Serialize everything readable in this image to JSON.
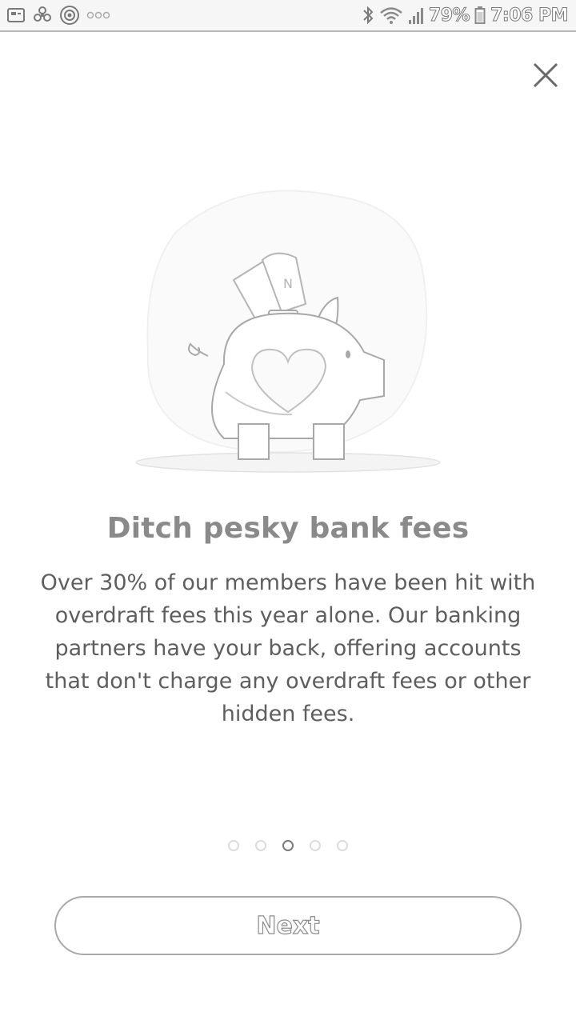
{
  "status_bar": {
    "notification_icons": [
      "gallery-notification-icon",
      "pinwheel-notification-icon",
      "target-notification-icon",
      "more-notifications-icon"
    ],
    "bluetooth_icon": "bluetooth-icon",
    "wifi_icon": "wifi-icon",
    "signal_icon": "signal-icon",
    "battery_percent": "79%",
    "battery_icon": "battery-icon",
    "time": "7:06 PM"
  },
  "onboarding": {
    "close_icon": "close-icon",
    "illustration": "piggy-bank-illustration",
    "title": "Ditch pesky bank fees",
    "body": "Over 30% of our members have been hit with overdraft fees this year alone. Our banking partners have your back, offering accounts that don't charge any overdraft fees or other hidden fees.",
    "pager": {
      "total": 5,
      "current": 3
    },
    "next_label": "Next"
  }
}
